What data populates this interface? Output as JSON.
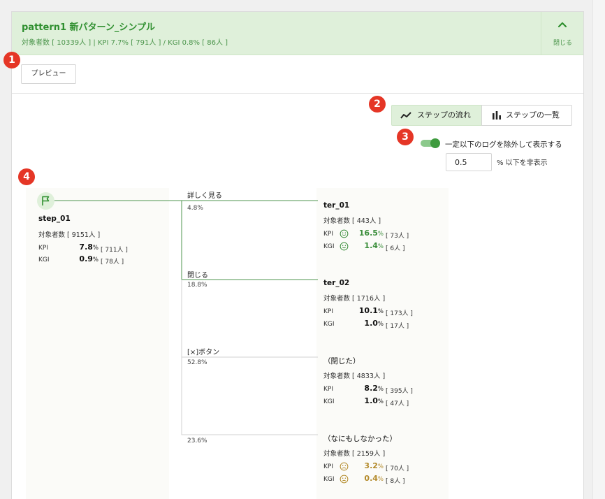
{
  "header": {
    "title": "pattern1 新パターン_シンプル",
    "summary": "対象者数 [ 10339人 ] | KPI 7.7% [ 791人 ] / KGI 0.8% [ 86人 ]",
    "collapse_label": "閉じる"
  },
  "preview_label": "プレビュー",
  "view_toggle": {
    "flow_label": "ステップの流れ",
    "list_label": "ステップの一覧",
    "selected": "flow"
  },
  "filter": {
    "enabled": true,
    "label": "一定以下のログを除外して表示する",
    "threshold": "0.5",
    "suffix": "% 以下を非表示"
  },
  "badges": [
    "1",
    "2",
    "3",
    "4"
  ],
  "colors": {
    "accent": "#3e9b3e",
    "header_bg": "#dff0da",
    "good": "#3b8e3b",
    "bad": "#b38a2a",
    "badge": "#e53626"
  },
  "start_node": {
    "icon": "flag-icon",
    "name": "step_01",
    "count": "対象者数 [ 9151人 ]",
    "kpi": {
      "label": "KPI",
      "value": "7.8",
      "unit": "%",
      "abs": "[ 711人 ]"
    },
    "kgi": {
      "label": "KGI",
      "value": "0.9",
      "unit": "%",
      "abs": "[ 78人 ]"
    }
  },
  "edges": [
    {
      "label": "詳しく見る",
      "pct": "4.8%"
    },
    {
      "label": "閉じる",
      "pct": "18.8%"
    },
    {
      "label": "[×]ボタン",
      "pct": "52.8%"
    },
    {
      "label": "",
      "pct": "23.6%"
    }
  ],
  "targets": [
    {
      "name": "ter_01",
      "count": "対象者数 [ 443人 ]",
      "kpi": {
        "label": "KPI",
        "value": "16.5",
        "unit": "%",
        "abs": "[ 73人 ]",
        "mood": "good"
      },
      "kgi": {
        "label": "KGI",
        "value": "1.4",
        "unit": "%",
        "abs": "[ 6人 ]",
        "mood": "good"
      }
    },
    {
      "name": "ter_02",
      "count": "対象者数 [ 1716人 ]",
      "kpi": {
        "label": "KPI",
        "value": "10.1",
        "unit": "%",
        "abs": "[ 173人 ]",
        "mood": "none"
      },
      "kgi": {
        "label": "KGI",
        "value": "1.0",
        "unit": "%",
        "abs": "[ 17人 ]",
        "mood": "none"
      }
    },
    {
      "name": "（閉じた）",
      "count": "対象者数 [ 4833人 ]",
      "kpi": {
        "label": "KPI",
        "value": "8.2",
        "unit": "%",
        "abs": "[ 395人 ]",
        "mood": "none"
      },
      "kgi": {
        "label": "KGI",
        "value": "1.0",
        "unit": "%",
        "abs": "[ 47人 ]",
        "mood": "none"
      }
    },
    {
      "name": "（なにもしなかった）",
      "count": "対象者数 [ 2159人 ]",
      "kpi": {
        "label": "KPI",
        "value": "3.2",
        "unit": "%",
        "abs": "[ 70人 ]",
        "mood": "bad"
      },
      "kgi": {
        "label": "KGI",
        "value": "0.4",
        "unit": "%",
        "abs": "[ 8人 ]",
        "mood": "bad"
      }
    }
  ]
}
